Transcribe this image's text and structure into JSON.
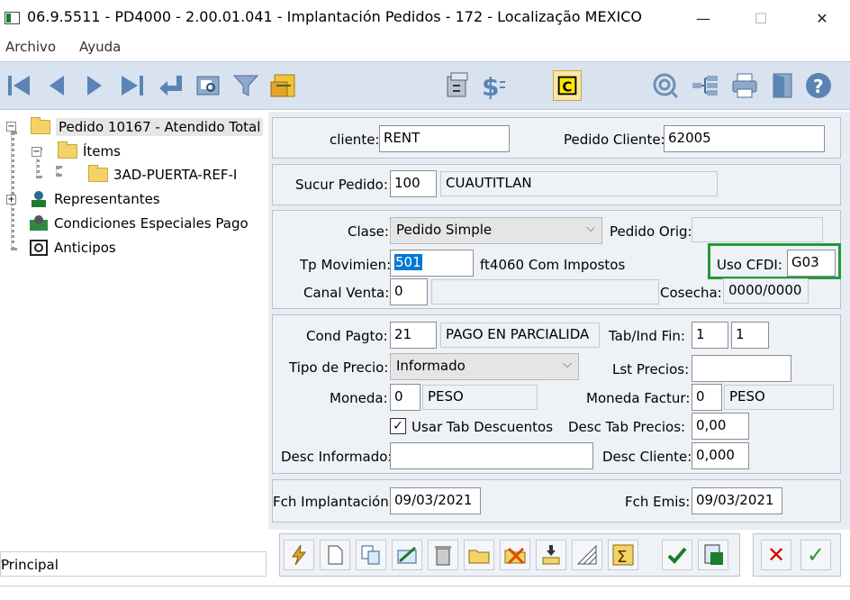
{
  "window": {
    "title": "06.9.5511 - PD4000 - 2.00.01.041 - Implantación Pedidos - 172 - Localização MEXICO",
    "minimize": "—",
    "maximize": "☐",
    "close": "✕"
  },
  "menu": {
    "items": [
      "Archivo",
      "Ayuda"
    ]
  },
  "toolbar": {
    "icons": [
      "first-record-icon",
      "previous-record-icon",
      "next-record-icon",
      "last-record-icon",
      "return-icon",
      "preview-icon",
      "filter-icon",
      "document-edit-icon",
      "calculator-icon",
      "currency-icon",
      "c-badge-icon",
      "search-globe-icon",
      "tree-structure-icon",
      "printer-icon",
      "exit-door-icon",
      "help-icon"
    ]
  },
  "tree": {
    "root": "Pedido 10167 - Atendido Total",
    "items_folder": "Ítems",
    "item": "3AD-PUERTA-REF-I",
    "representantes": "Representantes",
    "condiciones": "Condiciones Especiales Pago",
    "anticipos": "Anticipos"
  },
  "view_selector": {
    "value": "Principal",
    "chevron": "⌵"
  },
  "header": {
    "cliente_label": "cliente:",
    "cliente_value": "RENT",
    "pedido_cliente_label": "Pedido Cliente:",
    "pedido_cliente_value": "62005"
  },
  "sucursal": {
    "label": "Sucur Pedido:",
    "code": "100",
    "name": "CUAUTITLAN"
  },
  "clase": {
    "clase_label": "Clase:",
    "clase_value": "Pedido Simple",
    "pedido_orig_label": "Pedido Orig:",
    "pedido_orig_value": "",
    "tp_mov_label": "Tp Movimien:",
    "tp_mov_value": "501",
    "tp_mov_desc": "ft4060 Com Impostos",
    "uso_cfdi_label": "Uso CFDI:",
    "uso_cfdi_value": "G03",
    "canal_label": "Canal Venta:",
    "canal_value": "0",
    "canal_desc": "",
    "cosecha_label": "Cosecha:",
    "cosecha_value": "0000/0000"
  },
  "pago": {
    "cond_label": "Cond Pagto:",
    "cond_code": "21",
    "cond_desc": "PAGO EN PARCIALIDA",
    "tab_label": "Tab/Ind Fin:",
    "tab_value": "1",
    "ind_value": "1",
    "tipo_precio_label": "Tipo de Precio:",
    "tipo_precio_value": "Informado",
    "lst_precios_label": "Lst Precios:",
    "lst_precios_value": "",
    "moneda_label": "Moneda:",
    "moneda_code": "0",
    "moneda_name": "PESO",
    "moneda_fact_label": "Moneda Factur:",
    "moneda_fact_code": "0",
    "moneda_fact_name": "PESO",
    "usar_tab_label": "Usar Tab Descuentos",
    "usar_tab_checked": "✓",
    "desc_tab_label": "Desc Tab Precios:",
    "desc_tab_value": "0,00",
    "desc_inf_label": "Desc Informado:",
    "desc_inf_value": "",
    "desc_cliente_label": "Desc Cliente:",
    "desc_cliente_value": "0,000"
  },
  "fechas": {
    "impl_label": "Fch Implantación:",
    "impl_value": "09/03/2021",
    "emis_label": "Fch Emis:",
    "emis_value": "09/03/2021"
  },
  "actions": {
    "icons": [
      "lightning-icon",
      "new-document-icon",
      "copy-document-icon",
      "edit-lines-icon",
      "delete-trash-icon",
      "open-folder-icon",
      "close-folder-icon",
      "download-icon",
      "hatch-icon",
      "sum-icon",
      "approve-icon",
      "calculator-list-icon"
    ],
    "cancel": "✕",
    "confirm": "✓"
  },
  "colors": {
    "highlight_box": "#1f9b3a",
    "toolbar_bg": "#d9e3f0",
    "selection": "#0078d7"
  }
}
